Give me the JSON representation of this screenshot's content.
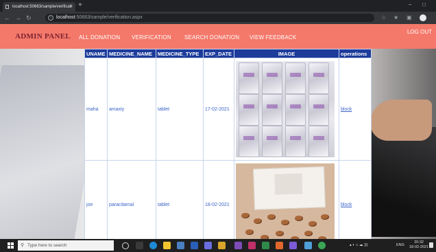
{
  "browser": {
    "tab_title": "localhost:50663/sample/verificati",
    "tab_close": "×",
    "new_tab": "+",
    "url_host": "localhost",
    "url_rest": ":50663/sample/verification.aspx",
    "win_min": "–",
    "win_max": "□"
  },
  "admin": {
    "brand": "ADMIN PANEL",
    "nav": [
      "ALL DONATION",
      "VERIFICATION",
      "SEARCH DONATION",
      "VIEW FEEDBACK"
    ],
    "logout": "LOG OUT"
  },
  "table": {
    "headers": [
      "UNAME",
      "MEDICINE_NAME",
      "MEDICINE_TYPE",
      "EXP_DATE",
      "IMAGE",
      "operations"
    ],
    "rows": [
      {
        "uname": "maha",
        "medicine_name": "amaxiy",
        "medicine_type": "tablet",
        "exp_date": "17-02-2021",
        "operation": "block"
      },
      {
        "uname": "joe",
        "medicine_name": "paracitamal",
        "medicine_type": "tablet",
        "exp_date": "18-02-2021",
        "operation": "block"
      }
    ]
  },
  "taskbar": {
    "search_placeholder": "Type here to search",
    "lang": "ENG",
    "time": "20:32",
    "date": "18-02-2021"
  }
}
